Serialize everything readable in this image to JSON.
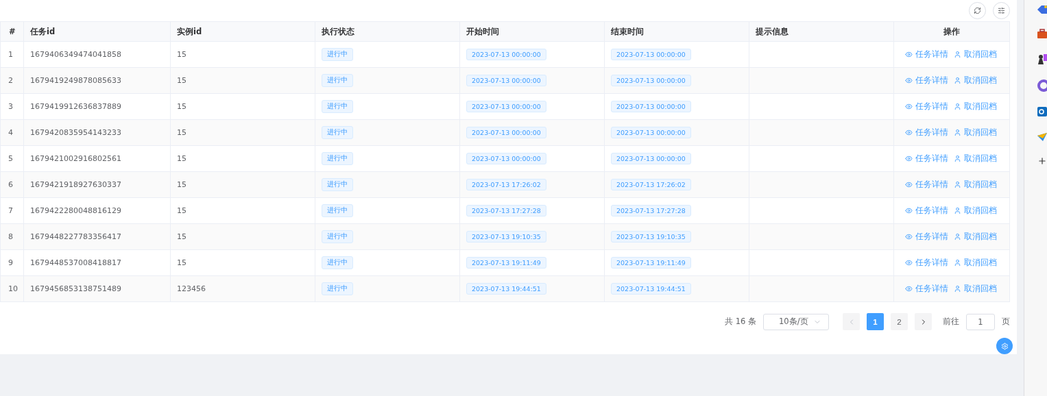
{
  "table": {
    "columns": [
      "#",
      "任务id",
      "实例id",
      "执行状态",
      "开始时间",
      "结束时间",
      "提示信息",
      "操作"
    ],
    "rows": [
      {
        "index": "1",
        "task_id": "1679406349474041858",
        "instance_id": "15",
        "status": "进行中",
        "start": "2023-07-13 00:00:00",
        "end": "2023-07-13 00:00:00",
        "actions": [
          "任务详情",
          "取消回档"
        ]
      },
      {
        "index": "2",
        "task_id": "1679419249878085633",
        "instance_id": "15",
        "status": "进行中",
        "start": "2023-07-13 00:00:00",
        "end": "2023-07-13 00:00:00",
        "actions": [
          "任务详情",
          "取消回档"
        ]
      },
      {
        "index": "3",
        "task_id": "1679419912636837889",
        "instance_id": "15",
        "status": "进行中",
        "start": "2023-07-13 00:00:00",
        "end": "2023-07-13 00:00:00",
        "actions": [
          "任务详情",
          "取消回档"
        ]
      },
      {
        "index": "4",
        "task_id": "1679420835954143233",
        "instance_id": "15",
        "status": "进行中",
        "start": "2023-07-13 00:00:00",
        "end": "2023-07-13 00:00:00",
        "actions": [
          "任务详情",
          "取消回档"
        ]
      },
      {
        "index": "5",
        "task_id": "1679421002916802561",
        "instance_id": "15",
        "status": "进行中",
        "start": "2023-07-13 00:00:00",
        "end": "2023-07-13 00:00:00",
        "actions": [
          "任务详情",
          "取消回档"
        ]
      },
      {
        "index": "6",
        "task_id": "1679421918927630337",
        "instance_id": "15",
        "status": "进行中",
        "start": "2023-07-13 17:26:02",
        "end": "2023-07-13 17:26:02",
        "actions": [
          "任务详情",
          "取消回档"
        ]
      },
      {
        "index": "7",
        "task_id": "1679422280048816129",
        "instance_id": "15",
        "status": "进行中",
        "start": "2023-07-13 17:27:28",
        "end": "2023-07-13 17:27:28",
        "actions": [
          "任务详情",
          "取消回档"
        ]
      },
      {
        "index": "8",
        "task_id": "1679448227783356417",
        "instance_id": "15",
        "status": "进行中",
        "start": "2023-07-13 19:10:35",
        "end": "2023-07-13 19:10:35",
        "actions": [
          "任务详情",
          "取消回档"
        ]
      },
      {
        "index": "9",
        "task_id": "1679448537008418817",
        "instance_id": "15",
        "status": "进行中",
        "start": "2023-07-13 19:11:49",
        "end": "2023-07-13 19:11:49",
        "actions": [
          "任务详情",
          "取消回档"
        ]
      },
      {
        "index": "10",
        "task_id": "1679456853138751489",
        "instance_id": "123456",
        "status": "进行中",
        "start": "2023-07-13 19:44:51",
        "end": "2023-07-13 19:44:51",
        "actions": [
          "任务详情",
          "取消回档"
        ]
      }
    ]
  },
  "pagination": {
    "total": "共 16 条",
    "page_size": "10条/页",
    "pages": [
      {
        "label": "1",
        "selected": true
      },
      {
        "label": "2",
        "selected": false
      }
    ],
    "goto_label": "前往",
    "goto_value": "1",
    "page_suffix": "页"
  }
}
